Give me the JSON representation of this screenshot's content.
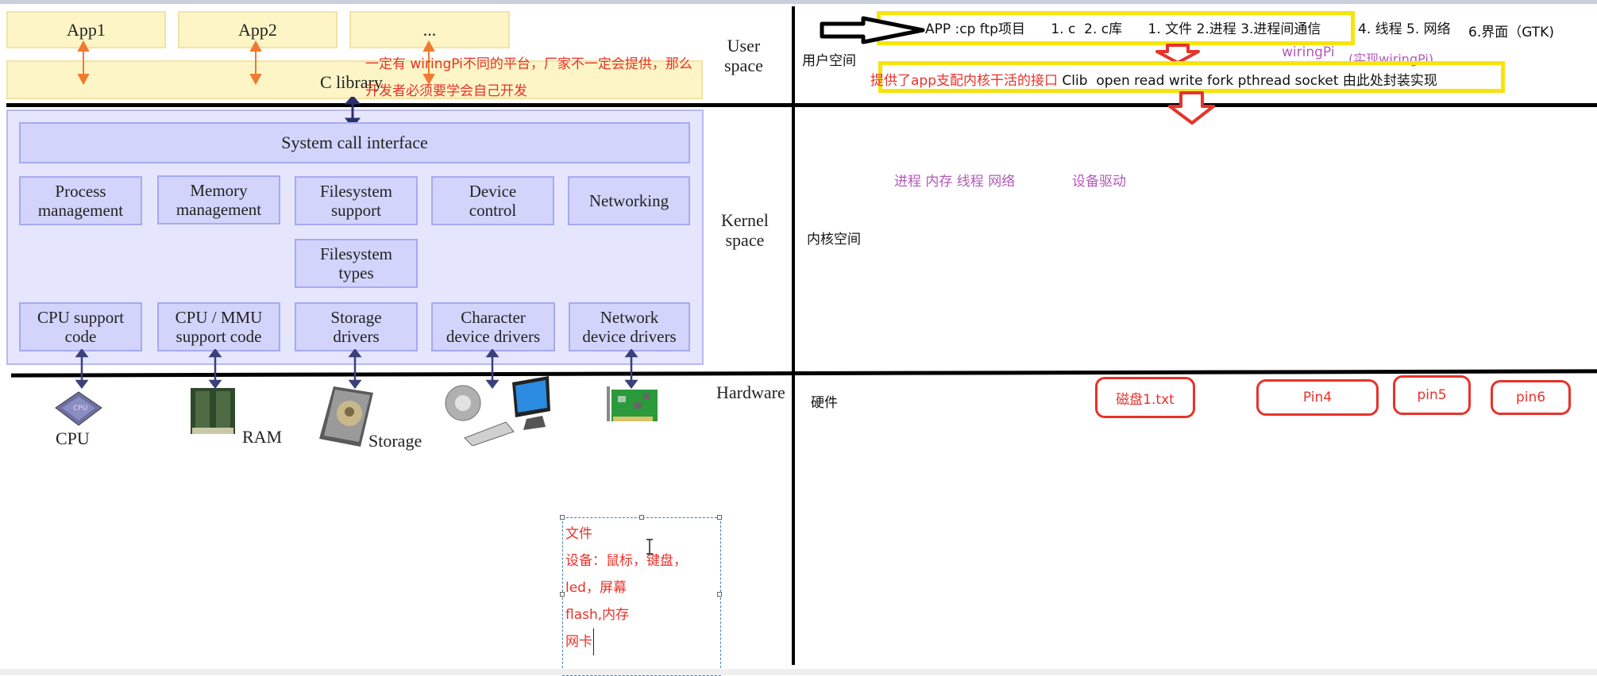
{
  "left_diagram": {
    "apps": [
      "App1",
      "App2",
      "..."
    ],
    "c_library": "C library",
    "system_call_interface": "System call interface",
    "kernel_row1": [
      {
        "line1": "Process",
        "line2": "management"
      },
      {
        "line1": "Memory",
        "line2": "management"
      },
      {
        "line1": "Filesystem",
        "line2": "support"
      },
      {
        "line1": "Device",
        "line2": "control"
      },
      {
        "line1": "Networking",
        "line2": ""
      }
    ],
    "kernel_row2": {
      "line1": "Filesystem",
      "line2": "types"
    },
    "kernel_row3": [
      {
        "line1": "CPU support",
        "line2": "code"
      },
      {
        "line1": "CPU / MMU",
        "line2": "support code"
      },
      {
        "line1": "Storage",
        "line2": "drivers"
      },
      {
        "line1": "Character",
        "line2": "device drivers"
      },
      {
        "line1": "Network",
        "line2": "device drivers"
      }
    ],
    "hardware": [
      {
        "icon": "cpu-icon",
        "label": "CPU"
      },
      {
        "icon": "ram-icon",
        "label": "RAM"
      },
      {
        "icon": "storage-icon",
        "label": "Storage"
      },
      {
        "icon": "peripherals-icon",
        "label": ""
      },
      {
        "icon": "network-card-icon",
        "label": ""
      }
    ],
    "layer_labels": {
      "user_line1": "User",
      "user_line2": "space",
      "kernel_line1": "Kernel",
      "kernel_line2": "space",
      "hardware": "Hardware"
    },
    "annotation_line1": "一定有   wiringPi不同的平台，厂家不一定会提供，那么",
    "annotation_line2": "开发者必须要学会自己开发"
  },
  "right_notes": {
    "user_space_label": "用户空间",
    "app_line": "APP :cp ftp项目      1. c  2. c库      1. 文件 2.进程 3.进程间通信",
    "app_line_tail": "4. 线程 5. 网络",
    "gui_item": "6.界面（GTK)",
    "wiringpi_label": "wiringPi",
    "wiringpi_impl": "(实现wiringPi)",
    "clib_red": "提供了app支配内核干活的接口",
    "clib_black": " Clib  open read write fork pthread socket 由此处封装实现",
    "kernel_space_label": "内核空间",
    "kernel_items": "进程 内存 线程 网络",
    "device_driver": "设备驱动",
    "hardware_label": "硬件",
    "hw_boxes": [
      "磁盘1.txt",
      "Pin4",
      "pin5",
      "pin6"
    ]
  },
  "textbox": {
    "lines": [
      "文件",
      "设备：鼠标，键盘，",
      "led，屏幕",
      "flash,内存",
      "网卡"
    ]
  },
  "colors": {
    "highlight_yellow": "#f7e40b",
    "annotation_red": "#e8322a",
    "annotation_purple": "#b259b9",
    "kernel_box": "#d2d4fb",
    "app_box": "#fdf5c6"
  }
}
